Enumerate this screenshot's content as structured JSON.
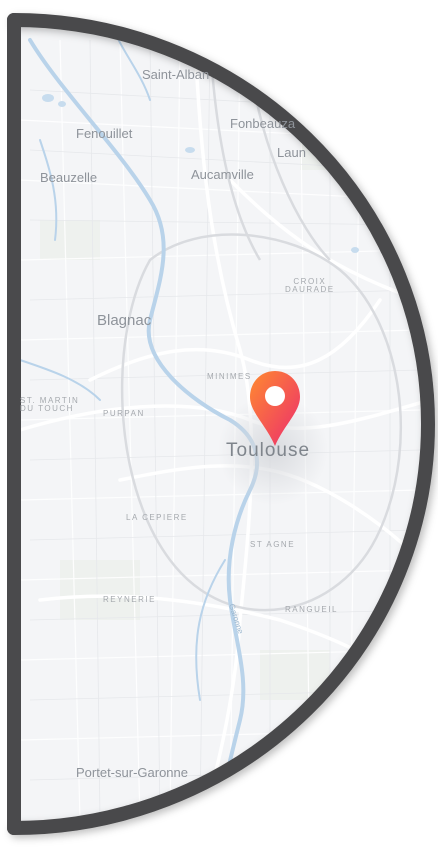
{
  "map": {
    "city_label": "Toulouse",
    "place_labels": [
      {
        "key": "saint-alban",
        "text": "Saint-Alban"
      },
      {
        "key": "fenouillet",
        "text": "Fenouillet"
      },
      {
        "key": "fonbeauzard",
        "text": "Fonbeauza"
      },
      {
        "key": "launaguet",
        "text": "Laun"
      },
      {
        "key": "beauzelle",
        "text": "Beauzelle"
      },
      {
        "key": "aucamville",
        "text": "Aucamville"
      },
      {
        "key": "blagnac",
        "text": "Blagnac"
      },
      {
        "key": "portet",
        "text": "Portet-sur-Garonne"
      }
    ],
    "district_labels": [
      {
        "key": "croix-daurade",
        "text": "CROIX\nDAURADE"
      },
      {
        "key": "minimes",
        "text": "MINIMES"
      },
      {
        "key": "st-martin",
        "text": "ST. MARTIN\nDU TOUCH"
      },
      {
        "key": "purpan",
        "text": "PURPAN"
      },
      {
        "key": "la-cepiere",
        "text": "LA CEPIERE"
      },
      {
        "key": "st-agne",
        "text": "ST AGNE"
      },
      {
        "key": "reynerie",
        "text": "REYNERIE"
      },
      {
        "key": "rangueil",
        "text": "RANGUEIL"
      }
    ],
    "river_label": "Garonne",
    "marker_icon": "map-pin-icon",
    "colors": {
      "frame": "#4a4a4c",
      "map_bg": "#f4f5f7",
      "water": "#b9d3ea",
      "roads": "#ffffff",
      "pin_top": "#ff8a30",
      "pin_bottom": "#ec2c6e"
    }
  }
}
